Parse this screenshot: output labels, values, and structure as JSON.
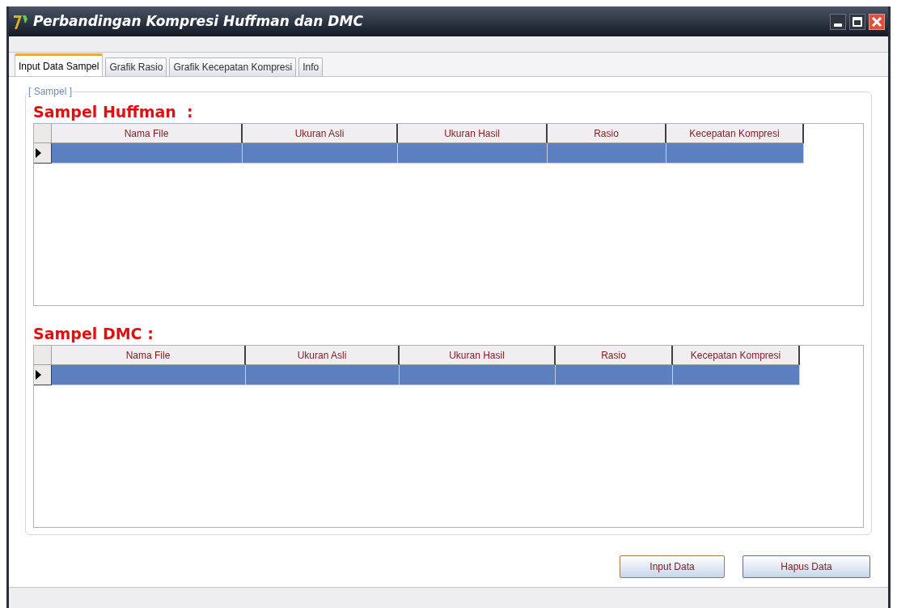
{
  "window": {
    "title": "Perbandingan Kompresi Huffman dan DMC"
  },
  "tabs": [
    {
      "label": "Input Data Sampel",
      "selected": true
    },
    {
      "label": "Grafik Rasio",
      "selected": false
    },
    {
      "label": "Grafik Kecepatan Kompresi",
      "selected": false
    },
    {
      "label": "Info",
      "selected": false
    }
  ],
  "group": {
    "title": "[ Sampel ]"
  },
  "grids": [
    {
      "heading": "Sampel Huffman  :",
      "columns": [
        "Nama File",
        "Ukuran Asli",
        "Ukuran Hasil",
        "Rasio",
        "Kecepatan Kompresi"
      ],
      "rows": [
        {
          "selected": true
        }
      ]
    },
    {
      "heading": "Sampel DMC :",
      "columns": [
        "Nama File",
        "Ukuran Asli",
        "Ukuran Hasil",
        "Rasio",
        "Kecepatan Kompresi"
      ],
      "rows": [
        {
          "selected": true
        }
      ]
    }
  ],
  "buttons": [
    {
      "label": "Input Data",
      "focused": true
    },
    {
      "label": "Hapus Data",
      "focused": false
    }
  ]
}
